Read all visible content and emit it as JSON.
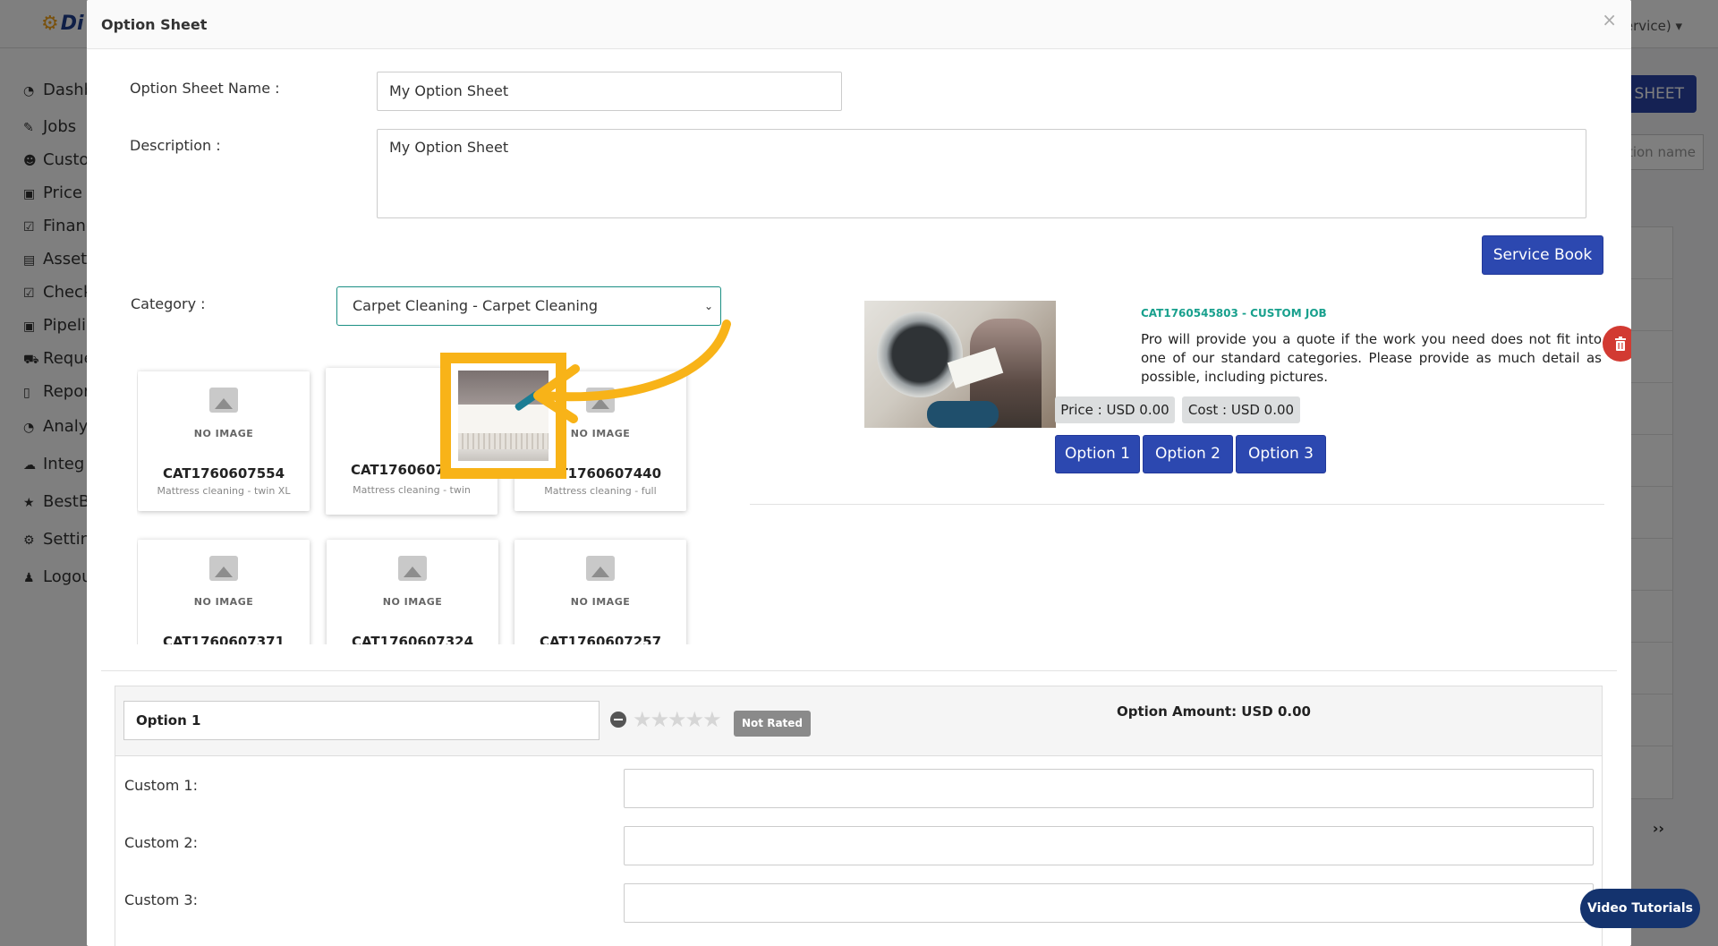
{
  "background": {
    "logo_text": "Di",
    "user_text": "Service)",
    "top_right_button": "N SHEET",
    "search_placeholder": "ption name",
    "pager_next": "››",
    "sidebar": [
      {
        "icon": "dashboard-icon",
        "glyph": "◔",
        "label": "Dashb"
      },
      {
        "icon": "wrench-icon",
        "glyph": "✎",
        "label": "Jobs"
      },
      {
        "icon": "users-icon",
        "glyph": "☻",
        "label": "Custo"
      },
      {
        "icon": "money-icon",
        "glyph": "▣",
        "label": "Price"
      },
      {
        "icon": "check-square-icon",
        "glyph": "☑",
        "label": "Financ"
      },
      {
        "icon": "archive-icon",
        "glyph": "▤",
        "label": "Asset"
      },
      {
        "icon": "check-square-icon",
        "glyph": "☑",
        "label": "Check"
      },
      {
        "icon": "money-icon",
        "glyph": "▣",
        "label": "Pipeli"
      },
      {
        "icon": "cart-icon",
        "glyph": "⛟",
        "label": "Reque"
      },
      {
        "icon": "file-icon",
        "glyph": "▯",
        "label": "Repor"
      },
      {
        "icon": "analytics-icon",
        "glyph": "◔",
        "label": "Analy"
      },
      {
        "icon": "cloud-icon",
        "glyph": "☁",
        "label": "Integ"
      },
      {
        "icon": "star-icon",
        "glyph": "★",
        "label": "BestB"
      },
      {
        "icon": "gear-icon",
        "glyph": "⚙",
        "label": "Settin"
      },
      {
        "icon": "user-icon",
        "glyph": "♟",
        "label": "Logou"
      }
    ]
  },
  "modal": {
    "title": "Option Sheet",
    "close_glyph": "×",
    "name_label": "Option Sheet Name :",
    "name_value": "My Option Sheet",
    "description_label": "Description :",
    "description_value": "My Option Sheet",
    "service_book_label": "Service Book",
    "category_label": "Category :",
    "category_value": "Carpet Cleaning - Carpet Cleaning",
    "no_image_text": "NO IMAGE",
    "cards": [
      {
        "code": "CAT1760607554",
        "sub": "Mattress cleaning - twin XL",
        "image": false
      },
      {
        "code": "CAT1760607490",
        "sub": "Mattress cleaning - twin",
        "image": true
      },
      {
        "code": "CAT1760607440",
        "sub": "Mattress cleaning - full",
        "image": false
      },
      {
        "code": "CAT1760607371",
        "sub": "",
        "image": false
      },
      {
        "code": "CAT1760607324",
        "sub": "",
        "image": false
      },
      {
        "code": "CAT1760607257",
        "sub": "",
        "image": false
      }
    ],
    "selected_item": {
      "code": "CAT1760545803 - CUSTOM JOB",
      "description": "Pro will provide you a quote if the work you need does not fit into one of our standard categories. Please provide as much detail as possible, including pictures.",
      "price_tag": "Price : USD 0.00",
      "cost_tag": "Cost : USD 0.00",
      "option_buttons": [
        "Option 1",
        "Option 2",
        "Option 3"
      ]
    },
    "option_panel": {
      "name_value": "Option 1",
      "rating_text": "Not Rated",
      "rating_value": 0,
      "rating_max": 5,
      "amount_text": "Option Amount: USD 0.00",
      "custom_fields": [
        {
          "label": "Custom 1:",
          "value": ""
        },
        {
          "label": "Custom 2:",
          "value": ""
        },
        {
          "label": "Custom 3:",
          "value": ""
        }
      ]
    }
  },
  "video_tutorials_label": "Video Tutorials",
  "colors": {
    "primary": "#2c48b0",
    "accent_teal": "#18a08d",
    "highlight": "#f8b318",
    "danger": "#d23a32",
    "tutorial": "#14336e"
  }
}
